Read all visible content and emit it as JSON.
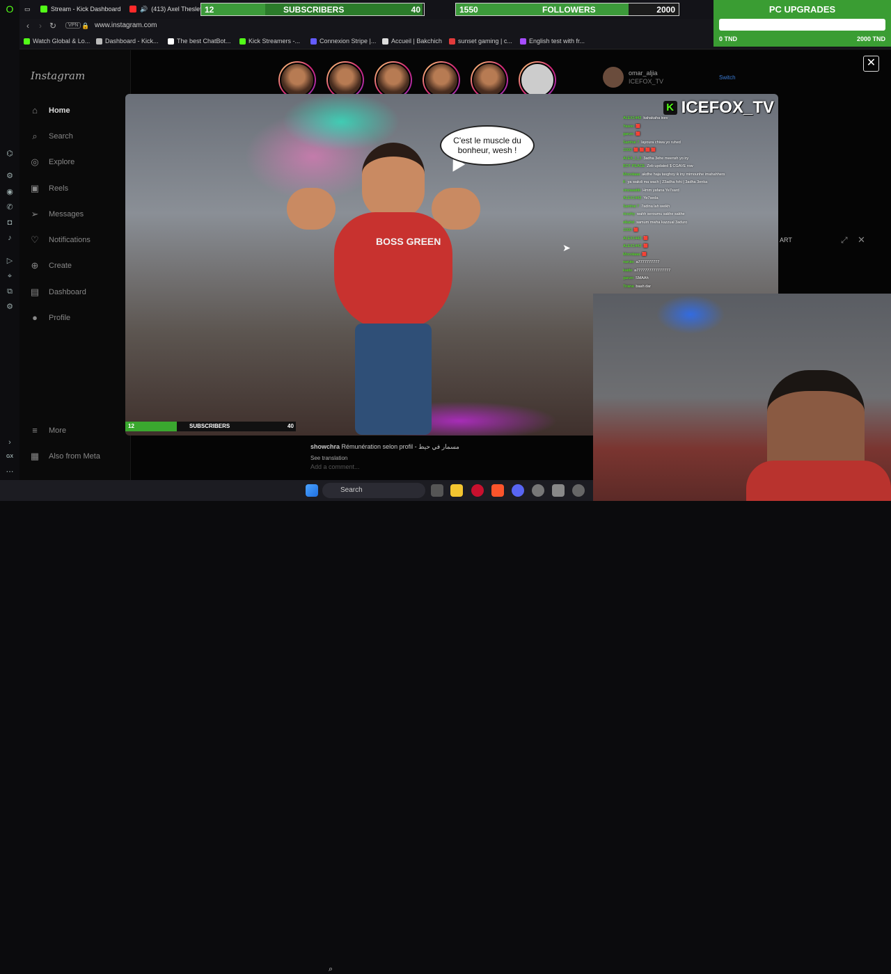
{
  "browser": {
    "tabs": [
      {
        "label": "Stream - Kick Dashboard",
        "color": "#53fc18"
      },
      {
        "label": "(413) Axel Theslef",
        "color": "#ff2a2a"
      }
    ],
    "url": "www.instagram.com",
    "vpn": "VPN",
    "bookmarks": [
      {
        "label": "Watch Global & Lo...",
        "color": "#53fc18"
      },
      {
        "label": "Dashboard - Kick...",
        "color": "#bbbbbb"
      },
      {
        "label": "The best ChatBot...",
        "color": "#ffffff"
      },
      {
        "label": "Kick Streamers -...",
        "color": "#53fc18"
      },
      {
        "label": "Connexion Stripe |...",
        "color": "#635bff"
      },
      {
        "label": "Accueil | Bakchich",
        "color": "#dddddd"
      },
      {
        "label": "sunset gaming | c...",
        "color": "#e23b3b"
      },
      {
        "label": "English test with fr...",
        "color": "#a64cff"
      }
    ]
  },
  "goals": {
    "subscribers": {
      "current": "12",
      "label": "SUBSCRIBERS",
      "target": "40",
      "progress": 0.3
    },
    "followers": {
      "current": "1550",
      "label": "FOLLOWERS",
      "target": "2000",
      "progress": 0.775
    },
    "pc_upgrades": {
      "title": "PC UPGRADES",
      "current": "0 TND",
      "target": "2000 TND",
      "progress": 0
    }
  },
  "instagram": {
    "logo": "Instagram",
    "nav": [
      {
        "label": "Home",
        "icon": "home-icon",
        "glyph": "⌂"
      },
      {
        "label": "Search",
        "icon": "search-icon",
        "glyph": "⌕"
      },
      {
        "label": "Explore",
        "icon": "compass-icon",
        "glyph": "◎"
      },
      {
        "label": "Reels",
        "icon": "reels-icon",
        "glyph": "▣"
      },
      {
        "label": "Messages",
        "icon": "messages-icon",
        "glyph": "➢"
      },
      {
        "label": "Notifications",
        "icon": "heart-icon",
        "glyph": "♡"
      },
      {
        "label": "Create",
        "icon": "create-icon",
        "glyph": "⊕"
      },
      {
        "label": "Dashboard",
        "icon": "dashboard-icon",
        "glyph": "▤"
      },
      {
        "label": "Profile",
        "icon": "avatar-icon",
        "glyph": "●"
      }
    ],
    "more": "More",
    "also_from_meta": "Also from Meta",
    "profile": {
      "name": "omar_aljia",
      "handle": "ICEFOX_TV",
      "switch": "Switch"
    },
    "comment": {
      "user": "showchra",
      "text": "Rémunération selon profil - مسمار في حيط",
      "see_translation": "See translation",
      "add_comment": "Add a comment..."
    },
    "mini_player_label": "ART"
  },
  "stream": {
    "channel": "ICEFOX_TV",
    "speech": "C'est le muscle du bonheur, wesh !",
    "shirt": "BOSS GREEN",
    "chat": [
      {
        "user": "ALEX1442",
        "msg": "kahakaha ixev"
      },
      {
        "user": "Yasoo",
        "msg": "🟥"
      },
      {
        "user": "ganzo",
        "msg": "🟥"
      },
      {
        "user": "Samhai 7",
        "msg": "layoura chiwa yo ruhed"
      },
      {
        "user": "1000",
        "msg": "🟥 🟥 🟥 🟥"
      },
      {
        "user": "ALEX_1_3",
        "msg": "3adha 3ehe meensh yo iry"
      },
      {
        "user": "BOT PEACE",
        "msg": "Zeb updated $ CGAVE row"
      },
      {
        "user": "Mooolaaa",
        "msg": "akdhe haja tasghoy ik iny mimounhe imahahhers"
      },
      {
        "user": "K",
        "msg": "ya wakdi ma wach | 23adha fohi | 3adha 3enka"
      },
      {
        "user": "vinzaaabb",
        "msg": "Hmm yafana Ye7sard"
      },
      {
        "user": "ALEX1442",
        "msg": "Ye7seda"
      },
      {
        "user": "Samhai 7",
        "msg": "7adina lah weikh"
      },
      {
        "user": "ricxzhy",
        "msg": "wahh seroumu sakhe sakhe"
      },
      {
        "user": "elkahd",
        "msg": "samum mwha kazzual 3aduro"
      },
      {
        "user": "1000",
        "msg": "🟥"
      },
      {
        "user": "ALEX1442",
        "msg": "🟥"
      },
      {
        "user": "ALEX1442",
        "msg": "🟥"
      },
      {
        "user": "Mooolaaa",
        "msg": "🟥"
      },
      {
        "user": "naruto",
        "msg": "a7777777777"
      },
      {
        "user": "kaido",
        "msg": "a7777777777777777"
      },
      {
        "user": "ganzo",
        "msg": "SMAAh"
      },
      {
        "user": "Tirana",
        "msg": "baah dar"
      }
    ]
  },
  "taskbar": {
    "search": "Search"
  },
  "gx_sidebar_icons": [
    "opera-gx-icon",
    "ai-icon",
    "settings-icon",
    "messenger-icon",
    "whatsapp-icon",
    "instagram-icon",
    "tiktok-icon",
    "player-icon",
    "pin-icon",
    "extensions-icon",
    "gear-icon"
  ],
  "gx_bottom": "GX"
}
